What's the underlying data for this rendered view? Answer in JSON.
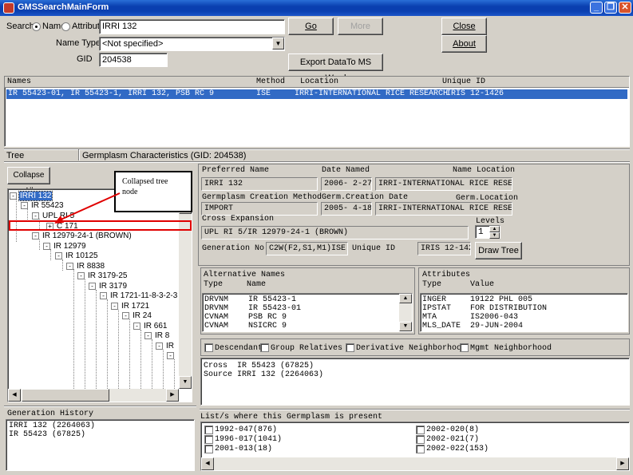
{
  "window": {
    "title": "GMSSearchMainForm",
    "min_glyph": "_",
    "max_glyph": "❐",
    "close_glyph": "✕"
  },
  "search": {
    "label": "Search",
    "radio_name": "Name",
    "radio_attribute": "Attribute",
    "value": "IRRI 132",
    "name_type_label": "Name Type",
    "name_type_value": "<Not specified>",
    "gid_label": "GID",
    "gid_value": "204538"
  },
  "buttons": {
    "go": "Go",
    "more": "More",
    "close": "Close",
    "about": "About",
    "export": "Export DataTo MS Word",
    "collapse_all": "Collapse All",
    "draw_tree": "Draw Tree"
  },
  "results": {
    "headers": [
      "Names",
      "Method",
      "Location",
      "Unique ID"
    ],
    "rows": [
      {
        "names": "IR 55423-01, IR 55423-1, IRRI 132, PSB RC 9",
        "method": "ISE",
        "location": "IRRI-INTERNATIONAL RICE RESEARCH",
        "unique_id": "IRIS 12-1426"
      }
    ]
  },
  "section_bar": {
    "tree": "Tree",
    "characteristics": "Germplasm Characteristics (GID: 204538)"
  },
  "tree": {
    "callout": "Collapsed tree node",
    "nodes": [
      {
        "label": "IRRI 132",
        "exp": "-"
      },
      {
        "label": "IR 55423",
        "exp": "-"
      },
      {
        "label": "UPL RI 5",
        "exp": "-"
      },
      {
        "label": "C 171",
        "exp": "+"
      },
      {
        "label": "IR 12979-24-1 (BROWN)",
        "exp": "-"
      },
      {
        "label": "IR 12979",
        "exp": "-"
      },
      {
        "label": "IR 10125",
        "exp": "-"
      },
      {
        "label": "IR 8838",
        "exp": "-"
      },
      {
        "label": "IR 3179-25",
        "exp": "-"
      },
      {
        "label": "IR 3179",
        "exp": "-"
      },
      {
        "label": "IR 1721-11-8-3-2-3",
        "exp": "-"
      },
      {
        "label": "IR 1721",
        "exp": "-"
      },
      {
        "label": "IR 24",
        "exp": "-"
      },
      {
        "label": "IR 661",
        "exp": "-"
      },
      {
        "label": "IR 8",
        "exp": "-"
      },
      {
        "label": "IR",
        "exp": "-"
      },
      {
        "label": "",
        "exp": "-"
      }
    ]
  },
  "characteristics": {
    "preferred_name_label": "Preferred Name",
    "preferred_name": "IRRI 132",
    "date_named_label": "Date Named",
    "date_named": "2006- 2-27",
    "name_location_label": "Name Location",
    "name_location": "IRRI-INTERNATIONAL RICE RESEARC",
    "creation_method_label": "Germplasm Creation Method",
    "creation_method": "IMPORT",
    "creation_date_label": "Germ.Creation Date",
    "creation_date": "2005- 4-18",
    "germ_location_label": "Germ.Location",
    "germ_location": "IRRI-INTERNATIONAL RICE RESEARC",
    "cross_expansion_label": "Cross Expansion",
    "cross_expansion": "UPL RI 5/IR 12979-24-1 (BROWN)",
    "levels_label": "Levels",
    "levels": "1",
    "generation_no_label": "Generation No.",
    "generation_no": "C2W(F2,S1,M1)ISE",
    "unique_id_label": "Unique ID",
    "unique_id": "IRIS 12-1426"
  },
  "alt_names": {
    "title": "Alternative Names",
    "col_type": "Type",
    "col_name": "Name",
    "rows": [
      {
        "type": "DRVNM",
        "name": "IR 55423-1"
      },
      {
        "type": "DRVNM",
        "name": "IR 55423-01"
      },
      {
        "type": "CVNAM",
        "name": "PSB RC 9"
      },
      {
        "type": "CVNAM",
        "name": "NSICRC 9"
      }
    ]
  },
  "attributes": {
    "title": "Attributes",
    "col_type": "Type",
    "col_value": "Value",
    "rows": [
      {
        "type": "INGER",
        "value": "19122 PHL 005"
      },
      {
        "type": "IPSTAT",
        "value": "FOR DISTRIBUTION"
      },
      {
        "type": "MTA",
        "value": "IS2006-043"
      },
      {
        "type": "MLS_DATE",
        "value": "29-JUN-2004"
      }
    ]
  },
  "options": {
    "descendants": "Descendants",
    "group_relatives": "Group Relatives",
    "derivative_neighborhood": "Derivative Neighborhood",
    "mgmt_neighborhood": "Mgmt Neighborhood"
  },
  "cross_info": {
    "line1": "Cross  IR 55423 (67825)",
    "line2": "Source IRRI 132 (2264063)"
  },
  "generation_history": {
    "title": "Generation History",
    "rows": [
      "IRRI 132 (2264063)",
      "IR 55423 (67825)"
    ]
  },
  "lists": {
    "title": "List/s where this Germplasm is present",
    "left": [
      "1992-047(876)",
      "1996-017(1041)",
      "2001-013(18)"
    ],
    "right": [
      "2002-020(8)",
      "2002-021(7)",
      "2002-022(153)"
    ]
  },
  "colors": {
    "selection": "#316ac5",
    "callout_red": "#e00000",
    "face": "#d4d0c8"
  }
}
